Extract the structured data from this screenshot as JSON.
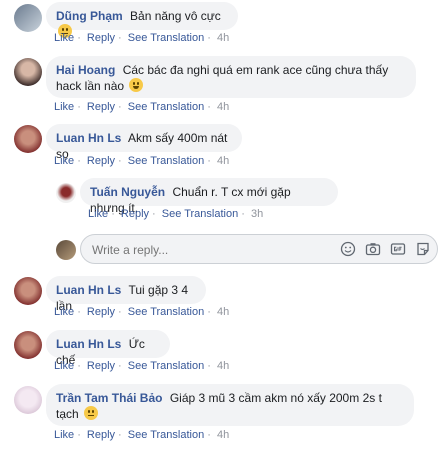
{
  "actions": {
    "like": "Like",
    "reply": "Reply",
    "see_translation": "See Translation"
  },
  "comments": [
    {
      "name": "Dũng Phạm",
      "text": "Bản năng vô cực",
      "emoji": "smile",
      "time": "4h"
    },
    {
      "name": "Hai Hoang",
      "text": "Các bác đa nghi quá em rank ace cũng chưa thấy hack lần nào",
      "emoji": "laugh",
      "time": "4h"
    },
    {
      "name": "Luan Hn Ls",
      "text": "Akm sấy 400m nát sọ",
      "time": "4h"
    },
    {
      "name": "Tuấn Nguyễn",
      "text": "Chuẩn r. T cx mới gặp nhưng ít.",
      "time": "3h"
    },
    {
      "name": "Luan Hn Ls",
      "text": "Tui gặp 3 4 lần",
      "time": "4h"
    },
    {
      "name": "Luan Hn Ls",
      "text": "Ức chế",
      "time": "4h"
    },
    {
      "name": "Trần Tam Thái Bảo",
      "text": "Giáp 3 mũ 3 cầm akm nó xấy 200m 2s t tạch",
      "emoji": "smile",
      "time": "4h"
    }
  ],
  "reply_box": {
    "placeholder": "Write a reply..."
  },
  "icons": [
    "emoji-icon",
    "camera-icon",
    "gif-icon",
    "sticker-icon"
  ],
  "colors": {
    "name": "#385898",
    "bubble": "#f2f3f5",
    "meta": "#90949c"
  }
}
